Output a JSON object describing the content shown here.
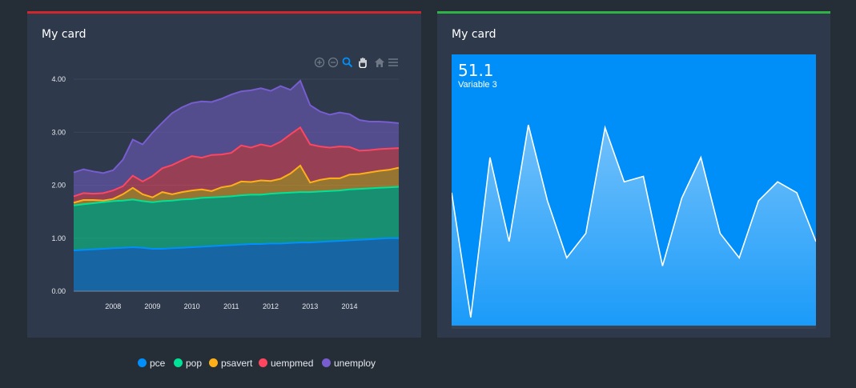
{
  "cards": [
    {
      "title": "My card",
      "accent": "#d0262c"
    },
    {
      "title": "My card",
      "accent": "#2fb344"
    }
  ],
  "toolbar": [
    {
      "name": "zoom-in-icon"
    },
    {
      "name": "zoom-out-icon"
    },
    {
      "name": "selection-zoom-icon"
    },
    {
      "name": "pan-icon"
    },
    {
      "name": "reset-zoom-icon"
    },
    {
      "name": "menu-icon"
    }
  ],
  "chart_data": [
    {
      "type": "area",
      "stacked": true,
      "xlim": [
        2007.0,
        2015.25
      ],
      "ylim": [
        0,
        4.0
      ],
      "yticks": [
        "0.00",
        "1.00",
        "2.00",
        "3.00",
        "4.00"
      ],
      "xticks": [
        "2008",
        "2009",
        "2010",
        "2011",
        "2012",
        "2013",
        "2014"
      ],
      "grid": true,
      "legend_position": "bottom",
      "x": [
        2007.0,
        2007.25,
        2007.5,
        2007.75,
        2008.0,
        2008.25,
        2008.5,
        2008.75,
        2009.0,
        2009.25,
        2009.5,
        2009.75,
        2010.0,
        2010.25,
        2010.5,
        2010.75,
        2011.0,
        2011.25,
        2011.5,
        2011.75,
        2012.0,
        2012.25,
        2012.5,
        2012.75,
        2013.0,
        2013.25,
        2013.5,
        2013.75,
        2014.0,
        2014.25,
        2014.5,
        2014.75,
        2015.0,
        2015.25
      ],
      "series": [
        {
          "name": "pce",
          "color": "#008ffb",
          "values": [
            0.77,
            0.78,
            0.79,
            0.8,
            0.81,
            0.82,
            0.83,
            0.82,
            0.8,
            0.8,
            0.81,
            0.82,
            0.83,
            0.84,
            0.85,
            0.86,
            0.87,
            0.88,
            0.89,
            0.89,
            0.9,
            0.9,
            0.91,
            0.92,
            0.92,
            0.93,
            0.94,
            0.95,
            0.96,
            0.97,
            0.98,
            0.99,
            1.0,
            1.0
          ]
        },
        {
          "name": "pop",
          "color": "#00e396",
          "values": [
            0.85,
            0.86,
            0.87,
            0.88,
            0.89,
            0.89,
            0.9,
            0.88,
            0.88,
            0.9,
            0.9,
            0.91,
            0.91,
            0.92,
            0.92,
            0.92,
            0.92,
            0.93,
            0.93,
            0.93,
            0.94,
            0.95,
            0.95,
            0.95,
            0.95,
            0.95,
            0.95,
            0.95,
            0.96,
            0.96,
            0.96,
            0.96,
            0.96,
            0.97
          ]
        },
        {
          "name": "psavert",
          "color": "#feb019",
          "values": [
            0.05,
            0.08,
            0.06,
            0.03,
            0.04,
            0.12,
            0.22,
            0.13,
            0.09,
            0.17,
            0.12,
            0.14,
            0.16,
            0.16,
            0.12,
            0.18,
            0.2,
            0.26,
            0.24,
            0.27,
            0.24,
            0.27,
            0.36,
            0.5,
            0.18,
            0.22,
            0.24,
            0.23,
            0.28,
            0.28,
            0.3,
            0.32,
            0.33,
            0.36
          ]
        },
        {
          "name": "uempmed",
          "color": "#ff4560",
          "values": [
            0.12,
            0.13,
            0.12,
            0.14,
            0.16,
            0.15,
            0.23,
            0.24,
            0.4,
            0.45,
            0.55,
            0.6,
            0.65,
            0.6,
            0.68,
            0.62,
            0.62,
            0.68,
            0.65,
            0.68,
            0.65,
            0.7,
            0.74,
            0.72,
            0.72,
            0.63,
            0.58,
            0.6,
            0.52,
            0.44,
            0.42,
            0.41,
            0.4,
            0.37
          ]
        },
        {
          "name": "unemploy",
          "color": "#775dd0",
          "values": [
            0.45,
            0.45,
            0.42,
            0.38,
            0.38,
            0.5,
            0.68,
            0.7,
            0.82,
            0.86,
            0.98,
            1.0,
            1.0,
            1.06,
            1.0,
            1.05,
            1.1,
            1.02,
            1.08,
            1.06,
            1.05,
            1.05,
            0.84,
            0.88,
            0.74,
            0.66,
            0.62,
            0.64,
            0.62,
            0.58,
            0.54,
            0.52,
            0.5,
            0.47
          ]
        }
      ]
    },
    {
      "type": "area",
      "title": "51.1",
      "subtitle": "Variable 3",
      "ylim": [
        0,
        100
      ],
      "color": "#ffffff",
      "background": "#008ff8",
      "values": [
        49,
        3,
        62,
        31,
        74,
        46,
        25,
        34,
        73,
        53,
        55,
        22,
        47,
        62,
        34,
        25,
        46,
        53,
        49,
        31
      ]
    }
  ],
  "legend": [
    {
      "label": "pce",
      "color": "#008ffb"
    },
    {
      "label": "pop",
      "color": "#00e396"
    },
    {
      "label": "psavert",
      "color": "#feb019"
    },
    {
      "label": "uempmed",
      "color": "#ff4560"
    },
    {
      "label": "unemploy",
      "color": "#775dd0"
    }
  ]
}
